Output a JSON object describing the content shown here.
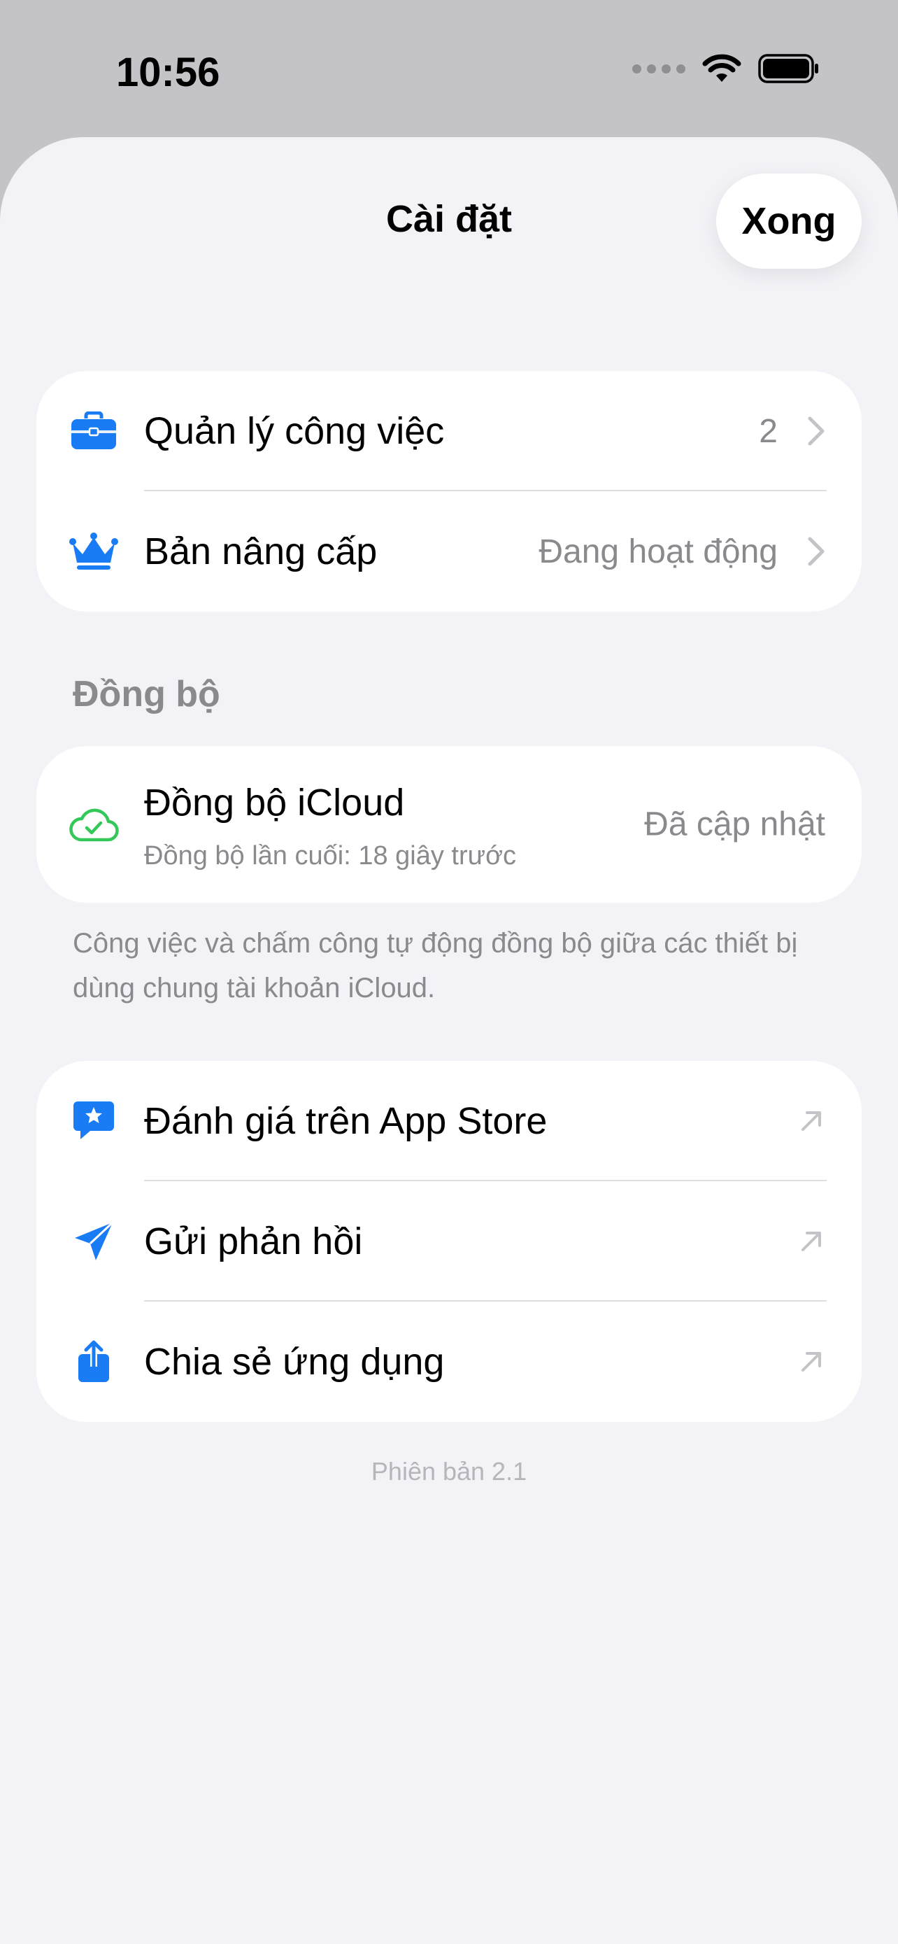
{
  "status_bar": {
    "time": "10:56"
  },
  "header": {
    "title": "Cài đặt",
    "done_label": "Xong"
  },
  "main_section": {
    "items": [
      {
        "label": "Quản lý công việc",
        "value": "2",
        "icon": "briefcase-icon"
      },
      {
        "label": "Bản nâng cấp",
        "value": "Đang hoạt động",
        "icon": "crown-icon"
      }
    ]
  },
  "sync_section": {
    "header": "Đồng bộ",
    "title": "Đồng bộ iCloud",
    "subtitle": "Đồng bộ lần cuối: 18 giây trước",
    "status": "Đã cập nhật",
    "icon": "cloud-check-icon",
    "footnote": "Công việc và chấm công tự động đồng bộ giữa các thiết bị dùng chung tài khoản iCloud."
  },
  "links_section": {
    "items": [
      {
        "label": "Đánh giá trên App Store",
        "icon": "star-bubble-icon"
      },
      {
        "label": "Gửi phản hồi",
        "icon": "paper-plane-icon"
      },
      {
        "label": "Chia sẻ ứng dụng",
        "icon": "share-icon"
      }
    ]
  },
  "footer": {
    "version": "Phiên bản 2.1"
  },
  "colors": {
    "accent": "#1a7cf5",
    "sync_green": "#34c759",
    "background": "#f2f2f7"
  }
}
